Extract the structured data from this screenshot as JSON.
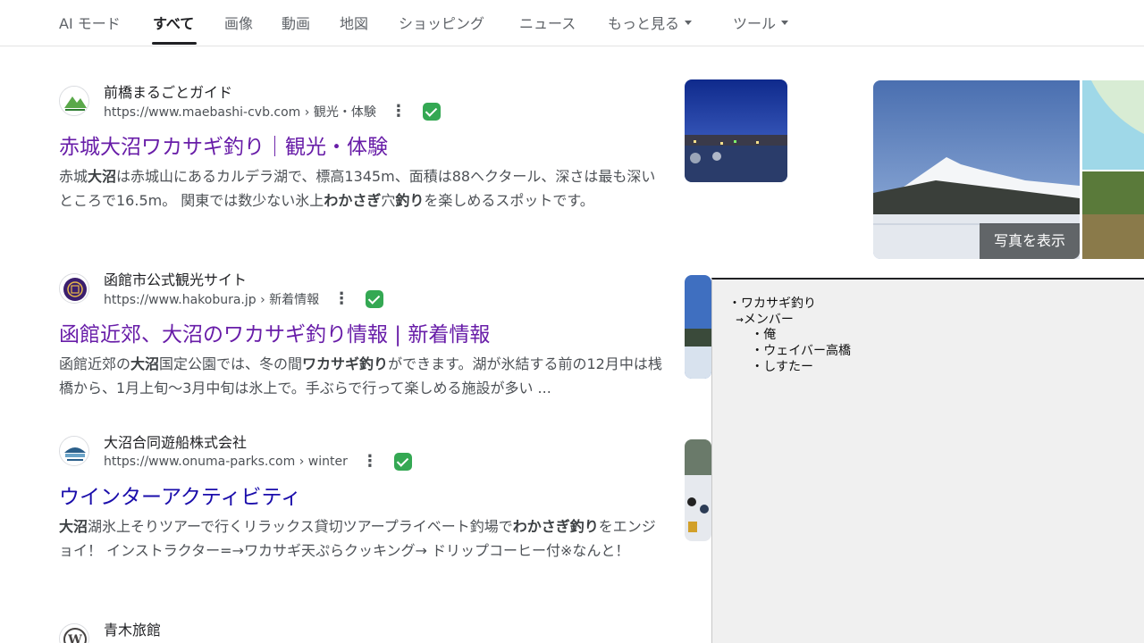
{
  "tabs": [
    {
      "label": "AI モード"
    },
    {
      "label": "すべて"
    },
    {
      "label": "画像"
    },
    {
      "label": "動画"
    },
    {
      "label": "地図"
    },
    {
      "label": "ショッピング"
    },
    {
      "label": "ニュース"
    },
    {
      "label": "もっと見る"
    },
    {
      "label": "ツール"
    }
  ],
  "active_tab": "すべて",
  "results": [
    {
      "site": "前橋まるごとガイド",
      "url": "https://www.maebashi-cvb.com › 観光・体験",
      "title": "赤城大沼ワカサギ釣り｜観光・体験",
      "snippet_parts": [
        "赤城",
        "大沼",
        "は赤城山にあるカルデラ湖で、標高1345m、面積は88ヘクタール、深さは最も深いところで16.5m。 関東では数少ない氷上",
        "わかさぎ",
        "穴",
        "釣り",
        "を楽しめるスポットです。"
      ]
    },
    {
      "site": "函館市公式観光サイト",
      "url": "https://www.hakobura.jp › 新着情報",
      "title": "函館近郊、大沼のワカサギ釣り情報 | 新着情報",
      "snippet_parts": [
        "函館近郊の",
        "大沼",
        "国定公園では、冬の間",
        "ワカサギ釣り",
        "ができます。湖が氷結する前の12月中は桟橋から、1月上旬〜3月中旬は氷上で。手ぶらで行って楽しめる施設が多い ..."
      ]
    },
    {
      "site": "大沼合同遊船株式会社",
      "url": "https://www.onuma-parks.com › winter",
      "title": "ウインターアクティビティ",
      "snippet_parts": [
        "大沼",
        "湖氷上そりツアーで行くリラックス貸切ツアープライベート釣場で",
        "わかさぎ釣り",
        "をエンジョイ！ インストラクター=→ワカサギ天ぷらクッキング→ ドリップコーヒー付※なんと！"
      ]
    },
    {
      "site": "青木旅館"
    }
  ],
  "knowledge_panel": {
    "show_photos_label": "写真を表示"
  },
  "notepad": {
    "lines": [
      "・ワカサギ釣り",
      " →メンバー",
      "   ・俺",
      "   ・ウェイバー高橋",
      "   ・しすたー"
    ]
  },
  "colors": {
    "visited_link": "#681da8",
    "link": "#1a0dab",
    "verified": "#34a853"
  }
}
